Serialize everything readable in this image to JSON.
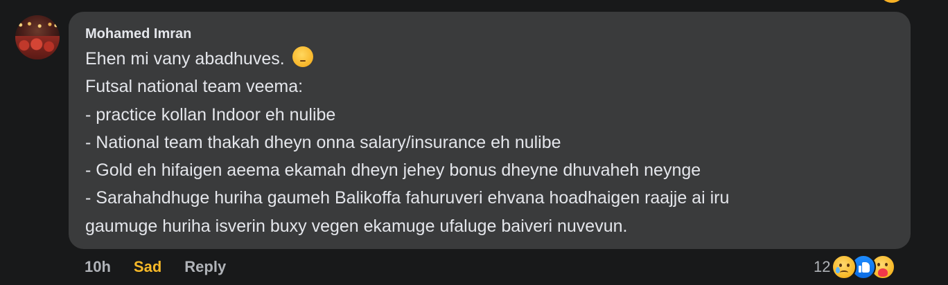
{
  "comment": {
    "author": "Mohamed Imran",
    "lines": [
      "Ehen mi vany abadhuves.",
      "Futsal national team veema:",
      "- practice kollan Indoor eh nulibe",
      "- National team thakah dheyn onna salary/insurance eh nulibe",
      "- Gold eh hifaigen aeema ekamah dheyn jehey bonus dheyne dhuvaheh neynge",
      "- Sarahahdhuge huriha gaumeh Balikoffa fahuruveri ehvana hoadhaigen raajje ai iru",
      "gaumuge huriha isverin buxy vegen ekamuge ufaluge baiveri nuvevun."
    ],
    "inline_emoji": "pensive-face-emoji"
  },
  "actions": {
    "time": "10h",
    "reaction_label": "Sad",
    "reply_label": "Reply"
  },
  "reactions": {
    "count": "12",
    "icons": [
      "sad-reaction-icon",
      "like-reaction-icon",
      "care-reaction-icon"
    ]
  },
  "colors": {
    "background": "#18191a",
    "bubble": "#3a3b3c",
    "text": "#e4e6eb",
    "muted": "#b0b3b8",
    "sad_accent": "#f7b928",
    "like_blue": "#1877f2"
  }
}
